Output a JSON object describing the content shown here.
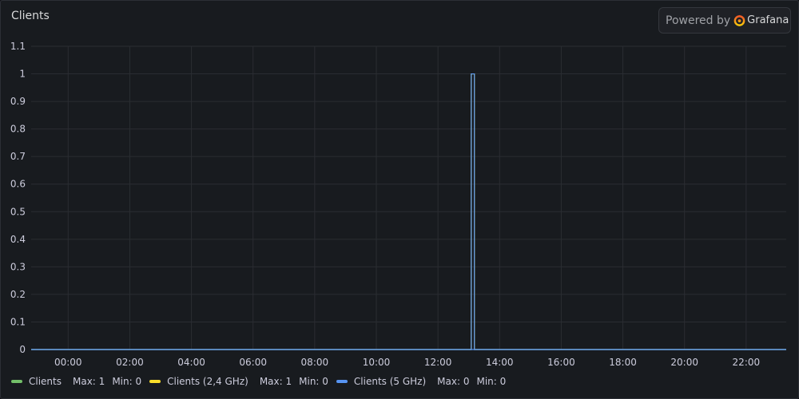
{
  "panel": {
    "title": "Clients",
    "powered_by_label": "Powered by",
    "brand": "Grafana"
  },
  "chart_data": {
    "type": "line",
    "title": "Clients",
    "x_ticks": [
      "00:00",
      "02:00",
      "04:00",
      "06:00",
      "08:00",
      "10:00",
      "12:00",
      "14:00",
      "16:00",
      "18:00",
      "20:00",
      "22:00"
    ],
    "y_ticks": [
      "0",
      "0.1",
      "0.2",
      "0.3",
      "0.4",
      "0.5",
      "0.6",
      "0.7",
      "0.8",
      "0.9",
      "1",
      "1.1"
    ],
    "xlim_hours": [
      -1.2,
      23.3
    ],
    "ylim": [
      0,
      1.1
    ],
    "grid": true,
    "legend_position": "bottom",
    "series": [
      {
        "name": "Clients",
        "color": "#73bf69",
        "max": "Max: 1",
        "min": "Min: 0",
        "points": [
          [
            -1.2,
            0
          ],
          [
            13.08,
            0
          ],
          [
            13.08,
            1
          ],
          [
            13.18,
            1
          ],
          [
            13.18,
            0
          ],
          [
            23.3,
            0
          ]
        ]
      },
      {
        "name": "Clients (2,4 GHz)",
        "color": "#fade2a",
        "max": "Max: 1",
        "min": "Min: 0",
        "points": [
          [
            -1.2,
            0
          ],
          [
            13.08,
            0
          ],
          [
            13.08,
            1
          ],
          [
            13.18,
            1
          ],
          [
            13.18,
            0
          ],
          [
            23.3,
            0
          ]
        ]
      },
      {
        "name": "Clients (5 GHz)",
        "color": "#5794f2",
        "max": "Max: 0",
        "min": "Min: 0",
        "points": [
          [
            -1.2,
            0
          ],
          [
            23.3,
            0
          ]
        ]
      }
    ]
  }
}
